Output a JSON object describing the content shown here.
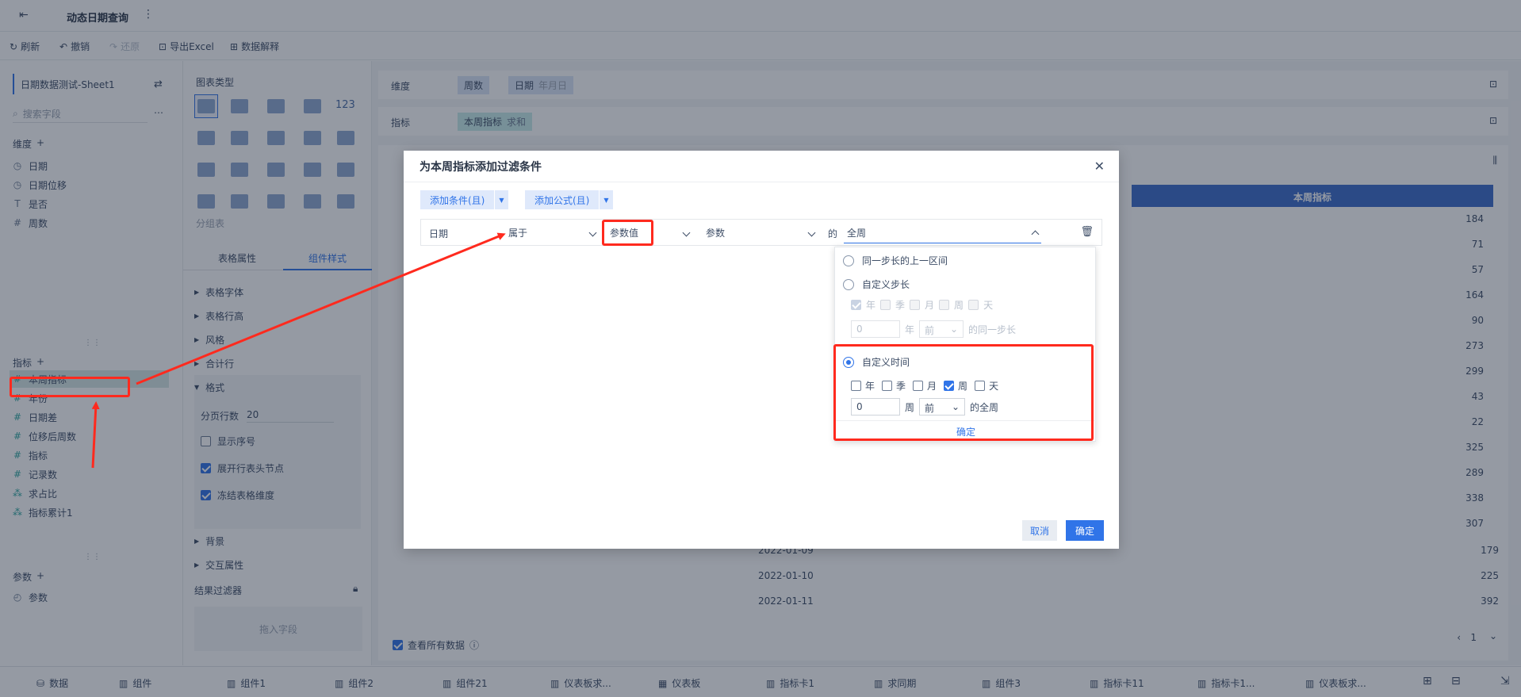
{
  "header": {
    "title": "动态日期查询"
  },
  "toolbar": {
    "refresh": "刷新",
    "undo": "撤销",
    "redo": "还原",
    "export": "导出Excel",
    "explain": "数据解释"
  },
  "left": {
    "dataset": "日期数据测试-Sheet1",
    "search_placeholder": "搜索字段",
    "dim_title": "维度",
    "dims": [
      "日期",
      "日期位移",
      "是否",
      "周数"
    ],
    "measure_title": "指标",
    "measures": [
      "本周指标",
      "年份",
      "日期差",
      "位移后周数",
      "指标",
      "记录数",
      "求占比",
      "指标累计1"
    ],
    "param_title": "参数",
    "params": [
      "参数"
    ]
  },
  "mid": {
    "chart_type_title": "图表类型",
    "group_table": "分组表",
    "tab_attr": "表格属性",
    "tab_style": "组件样式",
    "sections": [
      "表格字体",
      "表格行高",
      "风格",
      "合计行",
      "格式"
    ],
    "page_rows_label": "分页行数",
    "page_rows_value": "20",
    "show_index": "显示序号",
    "expand_header": "展开行表头节点",
    "freeze_dim": "冻结表格维度",
    "background": "背景",
    "interaction": "交互属性",
    "result_filter": "结果过滤器",
    "drop_field": "拖入字段"
  },
  "right": {
    "dim_label": "维度",
    "dim_tags": [
      "周数",
      "日期"
    ],
    "dim_tag_sub": "年月日",
    "measure_label": "指标",
    "measure_tag": "本周指标",
    "measure_tag_sub": "求和",
    "table_header": "本周指标",
    "values": [
      "184",
      "71",
      "57",
      "164",
      "90",
      "273",
      "299",
      "43",
      "22",
      "325",
      "289",
      "338",
      "307",
      "179",
      "225",
      "392"
    ],
    "dates": [
      "2022-01-09",
      "2022-01-10",
      "2022-01-11"
    ],
    "page": "1",
    "view_all": "查看所有数据"
  },
  "dialog": {
    "title": "为本周指标添加过滤条件",
    "add_condition": "添加条件(且)",
    "add_formula": "添加公式(且)",
    "field": "日期",
    "operator": "属于",
    "value_type": "参数值",
    "param": "参数",
    "of": "的",
    "range": "全周",
    "tooltip": "全周",
    "opt1": "同一步长的上一区间",
    "opt2": "自定义步长",
    "units": [
      "年",
      "季",
      "月",
      "周",
      "天"
    ],
    "step_value": "0",
    "step_unit": "年",
    "step_dir": "前",
    "step_suffix": "的同一步长",
    "opt3": "自定义时间",
    "custom_value": "0",
    "custom_unit": "周",
    "custom_dir": "前",
    "custom_suffix": "的全周",
    "confirm_small": "确定",
    "cancel": "取消",
    "ok": "确定"
  },
  "tabs": [
    "数据",
    "组件",
    "组件1",
    "组件2",
    "组件21",
    "仪表板求...",
    "仪表板",
    "指标卡1",
    "求同期",
    "组件3",
    "指标卡11",
    "指标卡1...",
    "仪表板求..."
  ],
  "colors": {
    "accent": "#3074e8",
    "highlight": "#ff2a1e",
    "tag_teal": "#c7ecea"
  }
}
